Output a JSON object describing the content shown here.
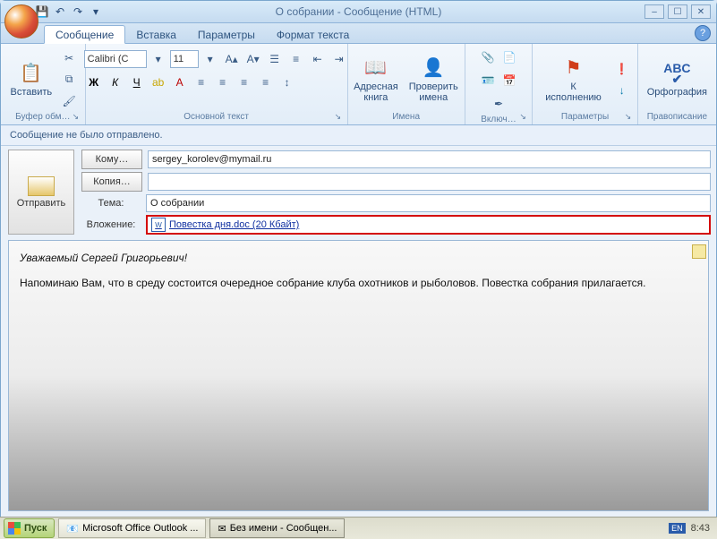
{
  "title": "О собрании - Сообщение (HTML)",
  "tabs": [
    "Сообщение",
    "Вставка",
    "Параметры",
    "Формат текста"
  ],
  "ribbon": {
    "clipboard": {
      "paste": "Вставить",
      "label": "Буфер обм…"
    },
    "font": {
      "name": "Calibri (С",
      "size": "11",
      "label": "Основной текст"
    },
    "names": {
      "ab": "Адресная книга",
      "check": "Проверить имена",
      "label": "Имена"
    },
    "include": {
      "label": "Включ…"
    },
    "followup": {
      "btn": "К исполнению",
      "label": "Параметры"
    },
    "spelling": {
      "btn": "Орфография",
      "label": "Правописание"
    }
  },
  "status": "Сообщение не было отправлено.",
  "send_label": "Отправить",
  "fields": {
    "to_btn": "Кому…",
    "to_value": "sergey_korolev@mymail.ru",
    "cc_btn": "Копия…",
    "cc_value": "",
    "subject_lbl": "Тема:",
    "subject_value": "О собрании",
    "attach_lbl": "Вложение:",
    "attach_value": "Повестка дня.doc (20 Кбайт)"
  },
  "body": {
    "greeting": "Уважаемый Сергей Григорьевич!",
    "paragraph": "Напоминаю Вам, что в среду состоится очередное собрание клуба охотников и рыболовов. Повестка собрания прилагается."
  },
  "taskbar": {
    "start": "Пуск",
    "items": [
      "Microsoft Office Outlook ...",
      "Без имени - Сообщен..."
    ],
    "lang": "EN",
    "clock": "8:43"
  }
}
